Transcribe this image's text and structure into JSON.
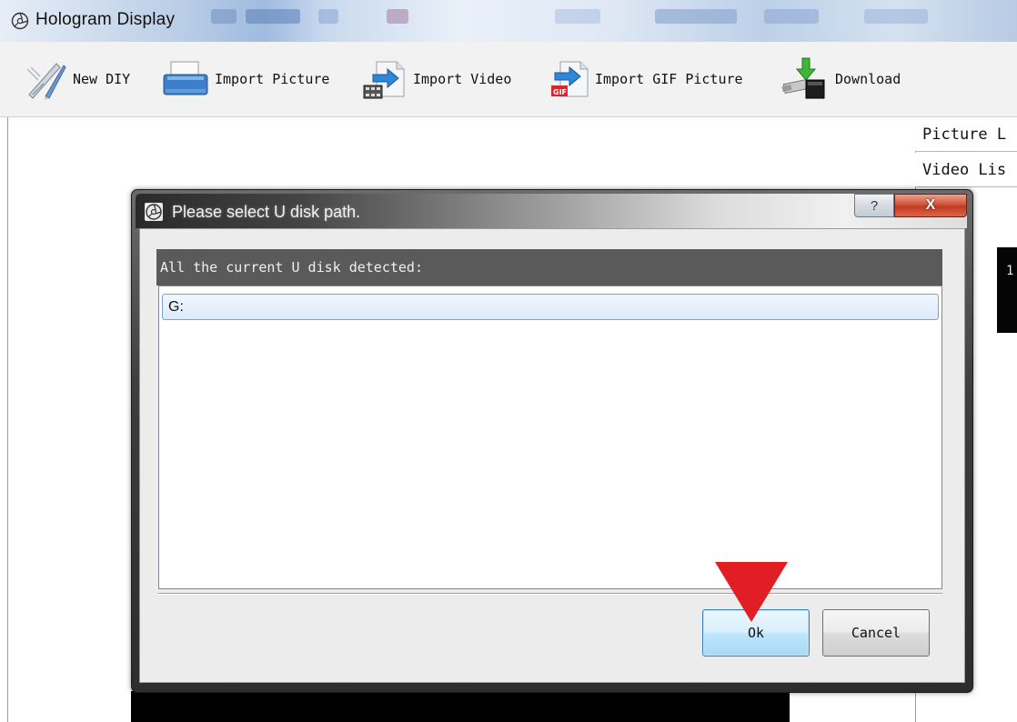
{
  "window": {
    "title": "Hologram Display",
    "icon": "app-logo-icon"
  },
  "toolbar": {
    "items": [
      {
        "label": "New DIY",
        "icon": "pencil-ruler-icon"
      },
      {
        "label": "Import Picture",
        "icon": "scanner-icon"
      },
      {
        "label": "Import Video",
        "icon": "video-file-arrow-icon"
      },
      {
        "label": "Import GIF Picture",
        "icon": "gif-file-arrow-icon"
      },
      {
        "label": "Download",
        "icon": "usb-download-icon"
      }
    ]
  },
  "side_panel": {
    "tabs": [
      {
        "label": "Picture L"
      },
      {
        "label": "Video Lis"
      }
    ],
    "thumb_text": "1"
  },
  "dialog": {
    "title": "Please select U disk path.",
    "help_label": "?",
    "close_label": "X",
    "header": "All the current U disk detected:",
    "disks": [
      "G:"
    ],
    "ok_label": "Ok",
    "cancel_label": "Cancel"
  },
  "colors": {
    "pointer_arrow": "#e01e24",
    "close_button": "#c23a1f",
    "header_bar": "#5a5a5a",
    "selection": "#dcebfc"
  }
}
